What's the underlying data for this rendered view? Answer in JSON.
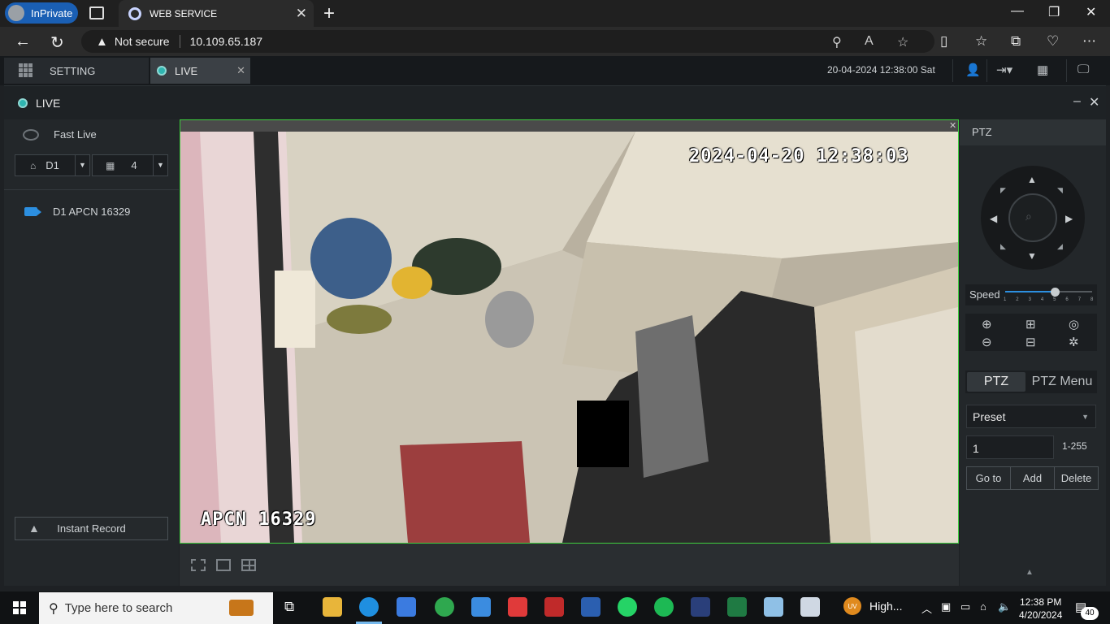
{
  "browser": {
    "inprivate_label": "InPrivate",
    "tab_title": "WEB SERVICE",
    "not_secure": "Not secure",
    "url": "10.109.65.187"
  },
  "app": {
    "setting_tab": "SETTING",
    "live_tab": "LIVE",
    "datetime": "20-04-2024 12:38:00 Sat",
    "live_header": "LIVE"
  },
  "left_panel": {
    "fast_live": "Fast Live",
    "channel_select": "D1",
    "split_select": "4",
    "device_item": "D1 APCN 16329",
    "instant_record": "Instant Record"
  },
  "video": {
    "osd_time": "2024-04-20 12:38:03",
    "osd_name": "APCN 16329"
  },
  "ptz": {
    "header": "PTZ",
    "speed_label": "Speed",
    "speed_ticks": [
      "1",
      "2",
      "3",
      "4",
      "5",
      "6",
      "7",
      "8"
    ],
    "speed_value": 5,
    "tab_ptz": "PTZ",
    "tab_ptz_menu": "PTZ Menu",
    "preset_select": "Preset",
    "preset_number": "1",
    "preset_range": "1-255",
    "goto": "Go to",
    "add": "Add",
    "delete": "Delete"
  },
  "taskbar": {
    "search_placeholder": "Type here to search",
    "high_item": "High...",
    "uv_badge": "UV",
    "clock_time": "12:38 PM",
    "clock_date": "4/20/2024",
    "notif_count": "40"
  },
  "colors": {
    "video_border": "#3fcf3f",
    "accent_blue": "#2c8fe0",
    "live_dot": "#2fb5b0"
  }
}
